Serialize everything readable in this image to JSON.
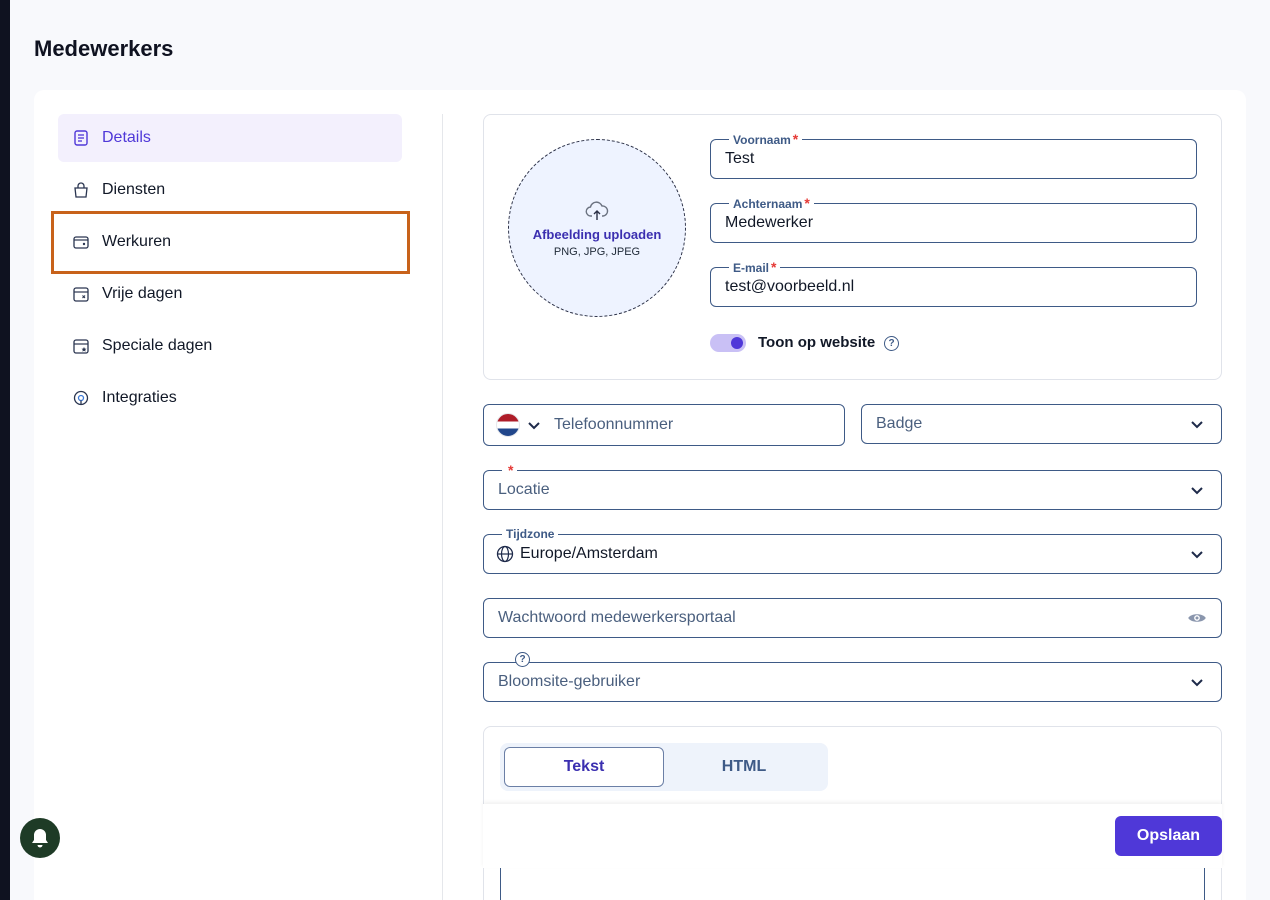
{
  "page": {
    "title": "Medewerkers"
  },
  "sidebar": {
    "items": [
      {
        "label": "Details",
        "icon": "document-icon",
        "active": true
      },
      {
        "label": "Diensten",
        "icon": "bag-icon"
      },
      {
        "label": "Werkuren",
        "icon": "wallet-icon"
      },
      {
        "label": "Vrije dagen",
        "icon": "calendar-x-icon"
      },
      {
        "label": "Speciale dagen",
        "icon": "calendar-star-icon"
      },
      {
        "label": "Integraties",
        "icon": "integration-icon"
      }
    ]
  },
  "upload": {
    "title": "Afbeelding uploaden",
    "formats": "PNG, JPG, JPEG"
  },
  "form": {
    "first_name": {
      "label": "Voornaam",
      "required_mark": "*",
      "value": "Test"
    },
    "last_name": {
      "label": "Achternaam",
      "required_mark": "*",
      "value": "Medewerker"
    },
    "email": {
      "label": "E-mail",
      "required_mark": "*",
      "value": "test@voorbeeld.nl"
    },
    "show_on_website": {
      "label": "Toon op website",
      "enabled": true,
      "help": "?"
    },
    "phone": {
      "placeholder": "Telefoonnummer",
      "country_flag": "netherlands-flag"
    },
    "badge": {
      "placeholder": "Badge"
    },
    "location": {
      "required_mark": "*",
      "placeholder": "Locatie"
    },
    "timezone": {
      "label": "Tijdzone",
      "value": "Europe/Amsterdam"
    },
    "password": {
      "placeholder": "Wachtwoord medewerkersportaal"
    },
    "bloomsite_user": {
      "placeholder": "Bloomsite-gebruiker",
      "help": "?"
    }
  },
  "editor": {
    "tabs": [
      {
        "label": "Tekst",
        "active": true
      },
      {
        "label": "HTML"
      }
    ]
  },
  "actions": {
    "save_label": "Opslaan"
  },
  "colors": {
    "accent": "#4f38d8",
    "border": "#3e5a86",
    "highlight": "#c8621a"
  }
}
